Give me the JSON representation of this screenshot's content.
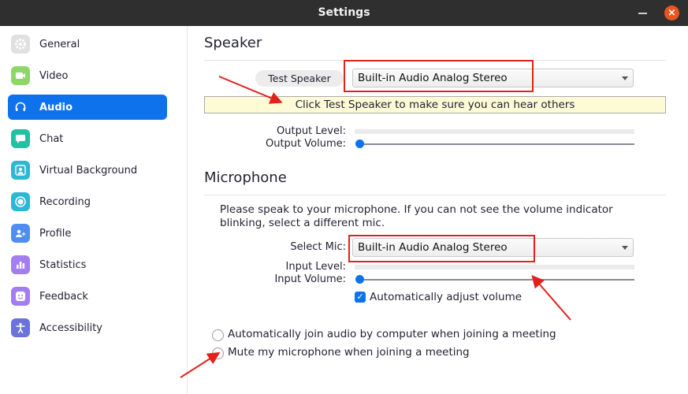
{
  "window": {
    "title": "Settings",
    "close_label": "×"
  },
  "sidebar": {
    "items": [
      {
        "label": "General",
        "icon": "gear-icon",
        "color": "#e0e0e0",
        "active": false
      },
      {
        "label": "Video",
        "icon": "video-camera-icon",
        "color": "#8fd66a",
        "active": false
      },
      {
        "label": "Audio",
        "icon": "headphones-icon",
        "color": "#0e72ed",
        "active": true
      },
      {
        "label": "Chat",
        "icon": "chat-bubble-icon",
        "color": "#1fc3a1",
        "active": false
      },
      {
        "label": "Virtual Background",
        "icon": "person-background-icon",
        "color": "#2bb8d4",
        "active": false
      },
      {
        "label": "Recording",
        "icon": "record-icon",
        "color": "#2bb8d4",
        "active": false
      },
      {
        "label": "Profile",
        "icon": "profile-sparkle-icon",
        "color": "#4f8ef0",
        "active": false
      },
      {
        "label": "Statistics",
        "icon": "bar-chart-icon",
        "color": "#a37ef0",
        "active": false
      },
      {
        "label": "Feedback",
        "icon": "smiley-face-icon",
        "color": "#a37ef0",
        "active": false
      },
      {
        "label": "Accessibility",
        "icon": "accessibility-person-icon",
        "color": "#6b72d8",
        "active": false
      }
    ]
  },
  "speaker": {
    "heading": "Speaker",
    "test_button": "Test Speaker",
    "device": "Built-in Audio Analog Stereo",
    "hint": "Click Test Speaker to make sure you can hear others",
    "output_level_label": "Output Level:",
    "output_level": 0,
    "output_volume_label": "Output Volume:",
    "output_volume": 0
  },
  "microphone": {
    "heading": "Microphone",
    "instructions": "Please speak to your microphone. If you can not see the volume indicator blinking, select a different mic.",
    "select_label": "Select Mic:",
    "device": "Built-in Audio Analog Stereo",
    "input_level_label": "Input Level:",
    "input_level": 0,
    "input_volume_label": "Input Volume:",
    "input_volume": 0,
    "auto_adjust_label": "Automatically adjust volume",
    "auto_adjust_checked": true
  },
  "options": {
    "auto_join_label": "Automatically join audio by computer when joining a meeting",
    "auto_join_checked": false,
    "mute_label": "Mute my microphone when joining a meeting",
    "mute_checked": false
  },
  "annotations": {
    "highlight_color": "#e3201b"
  }
}
